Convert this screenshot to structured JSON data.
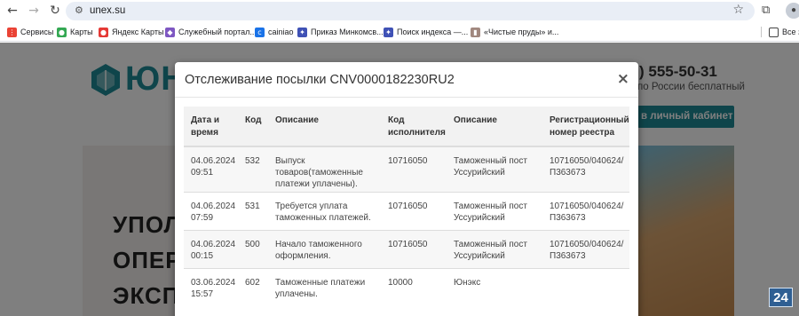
{
  "browser": {
    "url": "unex.su",
    "bookmarks": [
      {
        "label": "Сервисы",
        "icon": "apps-grid-icon",
        "color": "#ea4335"
      },
      {
        "label": "Карты",
        "icon": "maps-pin-icon",
        "color": "#34a853"
      },
      {
        "label": "Яндекс Карты",
        "icon": "yandex-maps-icon",
        "color": "#e53935"
      },
      {
        "label": "Служебный портал...",
        "icon": "cube-icon",
        "color": "#7e57c2"
      },
      {
        "label": "cainiao",
        "icon": "cainiao-icon",
        "color": "#1a73e8"
      },
      {
        "label": "Приказ Минкомсв...",
        "icon": "emblem-icon",
        "color": "#3f51b5"
      },
      {
        "label": "Поиск индекса —...",
        "icon": "emblem-icon",
        "color": "#3f51b5"
      },
      {
        "label": "«Чистые пруды» и...",
        "icon": "book-icon",
        "color": "#a1887f"
      }
    ],
    "all_bookmarks_label": "Все з"
  },
  "page": {
    "logo_text": "ЮН",
    "phone": ") 555-50-31",
    "phone_sub": "по России бесплатный",
    "cabinet_button": "в личный кабинет",
    "hero_lines": [
      "УПОЛ",
      "ОПЕР",
      "ЭКСП"
    ],
    "badge": "24"
  },
  "modal": {
    "title": "Отслеживание посылки CNV0000182230RU2",
    "close": "×",
    "columns": [
      "Дата и время",
      "Код",
      "Описание",
      "Код исполнителя",
      "Описание",
      "Регистрационный номер реестра"
    ],
    "rows": [
      [
        "04.06.2024 09:51",
        "532",
        "Выпуск товаров(таможенные платежи уплачены).",
        "10716050",
        "Таможенный пост Уссурийский",
        "10716050/040624/П363673"
      ],
      [
        "04.06.2024 07:59",
        "531",
        "Требуется уплата таможенных платежей.",
        "10716050",
        "Таможенный пост Уссурийский",
        "10716050/040624/П363673"
      ],
      [
        "04.06.2024 00:15",
        "500",
        "Начало таможенного оформления.",
        "10716050",
        "Таможенный пост Уссурийский",
        "10716050/040624/П363673"
      ],
      [
        "03.06.2024 15:57",
        "602",
        "Таможенные платежи уплачены.",
        "10000",
        "Юнэкс",
        ""
      ]
    ]
  }
}
